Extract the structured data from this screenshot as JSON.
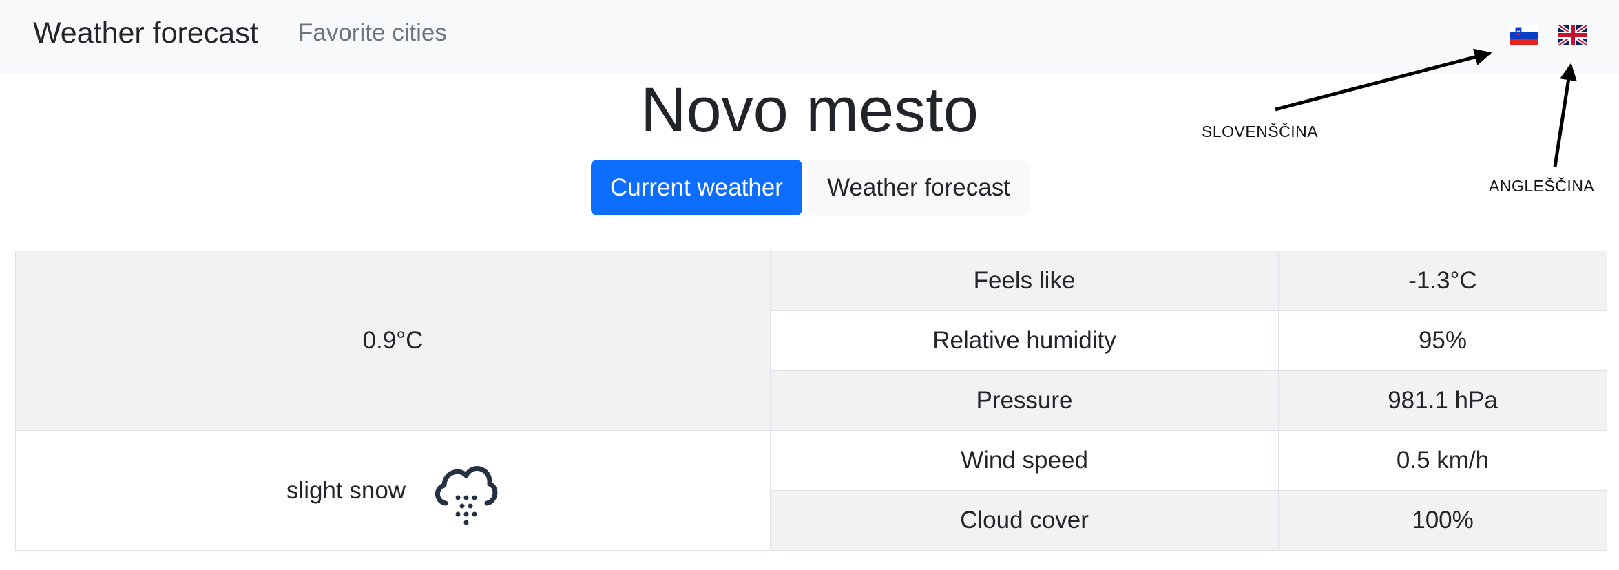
{
  "navbar": {
    "brand": "Weather forecast",
    "links": [
      "Favorite cities"
    ],
    "languages": [
      {
        "code": "sl",
        "icon": "slovenia-flag-icon"
      },
      {
        "code": "en",
        "icon": "uk-flag-icon"
      }
    ]
  },
  "annotations": {
    "slovene": "SLOVENŠČINA",
    "english": "ANGLEŠČINA"
  },
  "city": "Novo mesto",
  "tabs": [
    {
      "label": "Current weather",
      "active": true
    },
    {
      "label": "Weather forecast",
      "active": false
    }
  ],
  "current": {
    "temperature": "0.9°C",
    "description": "slight snow",
    "icon": "snow-cloud-icon",
    "rows": [
      {
        "label": "Feels like",
        "value": "-1.3°C"
      },
      {
        "label": "Relative humidity",
        "value": "95%"
      },
      {
        "label": "Pressure",
        "value": "981.1 hPa"
      },
      {
        "label": "Wind speed",
        "value": "0.5 km/h"
      },
      {
        "label": "Cloud cover",
        "value": "100%"
      }
    ]
  },
  "colors": {
    "primary": "#0d6efd",
    "navbar_bg": "#f8f9fa",
    "stripe": "#f2f2f2",
    "text": "#212529",
    "muted": "#6c757d"
  }
}
